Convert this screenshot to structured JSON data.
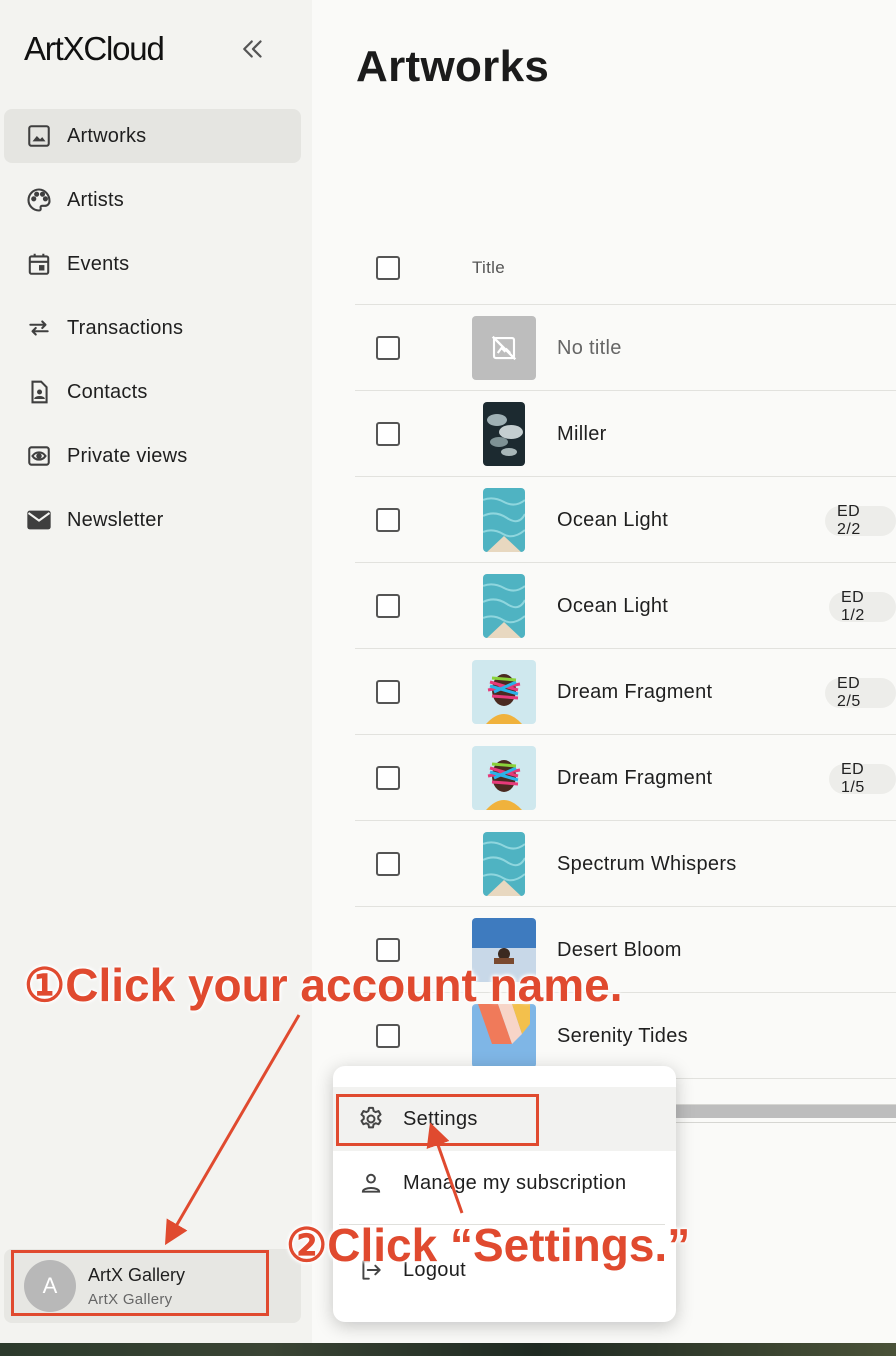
{
  "app": {
    "logo_left": "Art",
    "logo_x": "X",
    "logo_right": "Cloud"
  },
  "sidebar": {
    "items": [
      {
        "label": "Artworks",
        "icon": "image-icon",
        "active": true
      },
      {
        "label": "Artists",
        "icon": "palette-icon"
      },
      {
        "label": "Events",
        "icon": "calendar-icon"
      },
      {
        "label": "Transactions",
        "icon": "swap-arrows-icon"
      },
      {
        "label": "Contacts",
        "icon": "contact-card-icon"
      },
      {
        "label": "Private views",
        "icon": "eye-icon"
      },
      {
        "label": "Newsletter",
        "icon": "mail-icon"
      }
    ],
    "account": {
      "initial": "A",
      "name": "ArtX Gallery",
      "subtitle": "ArtX Gallery"
    }
  },
  "main": {
    "title": "Artworks",
    "table": {
      "header_title": "Title",
      "rows": [
        {
          "title": "No title",
          "badge": ""
        },
        {
          "title": "Miller",
          "badge": ""
        },
        {
          "title": "Ocean Light",
          "badge": "ED 2/2"
        },
        {
          "title": "Ocean Light",
          "badge": "ED 1/2"
        },
        {
          "title": "Dream Fragment",
          "badge": "ED 2/5"
        },
        {
          "title": "Dream Fragment",
          "badge": "ED 1/5"
        },
        {
          "title": "Spectrum Whispers",
          "badge": ""
        },
        {
          "title": "Desert Bloom",
          "badge": ""
        },
        {
          "title": "Serenity Tides",
          "badge": ""
        }
      ]
    }
  },
  "menu": {
    "settings": "Settings",
    "subscription": "Manage my subscription",
    "logout": "Logout"
  },
  "annotations": {
    "step1": "①Click your account name.",
    "step2": "②Click “Settings.”",
    "color": "#e04a2f"
  }
}
